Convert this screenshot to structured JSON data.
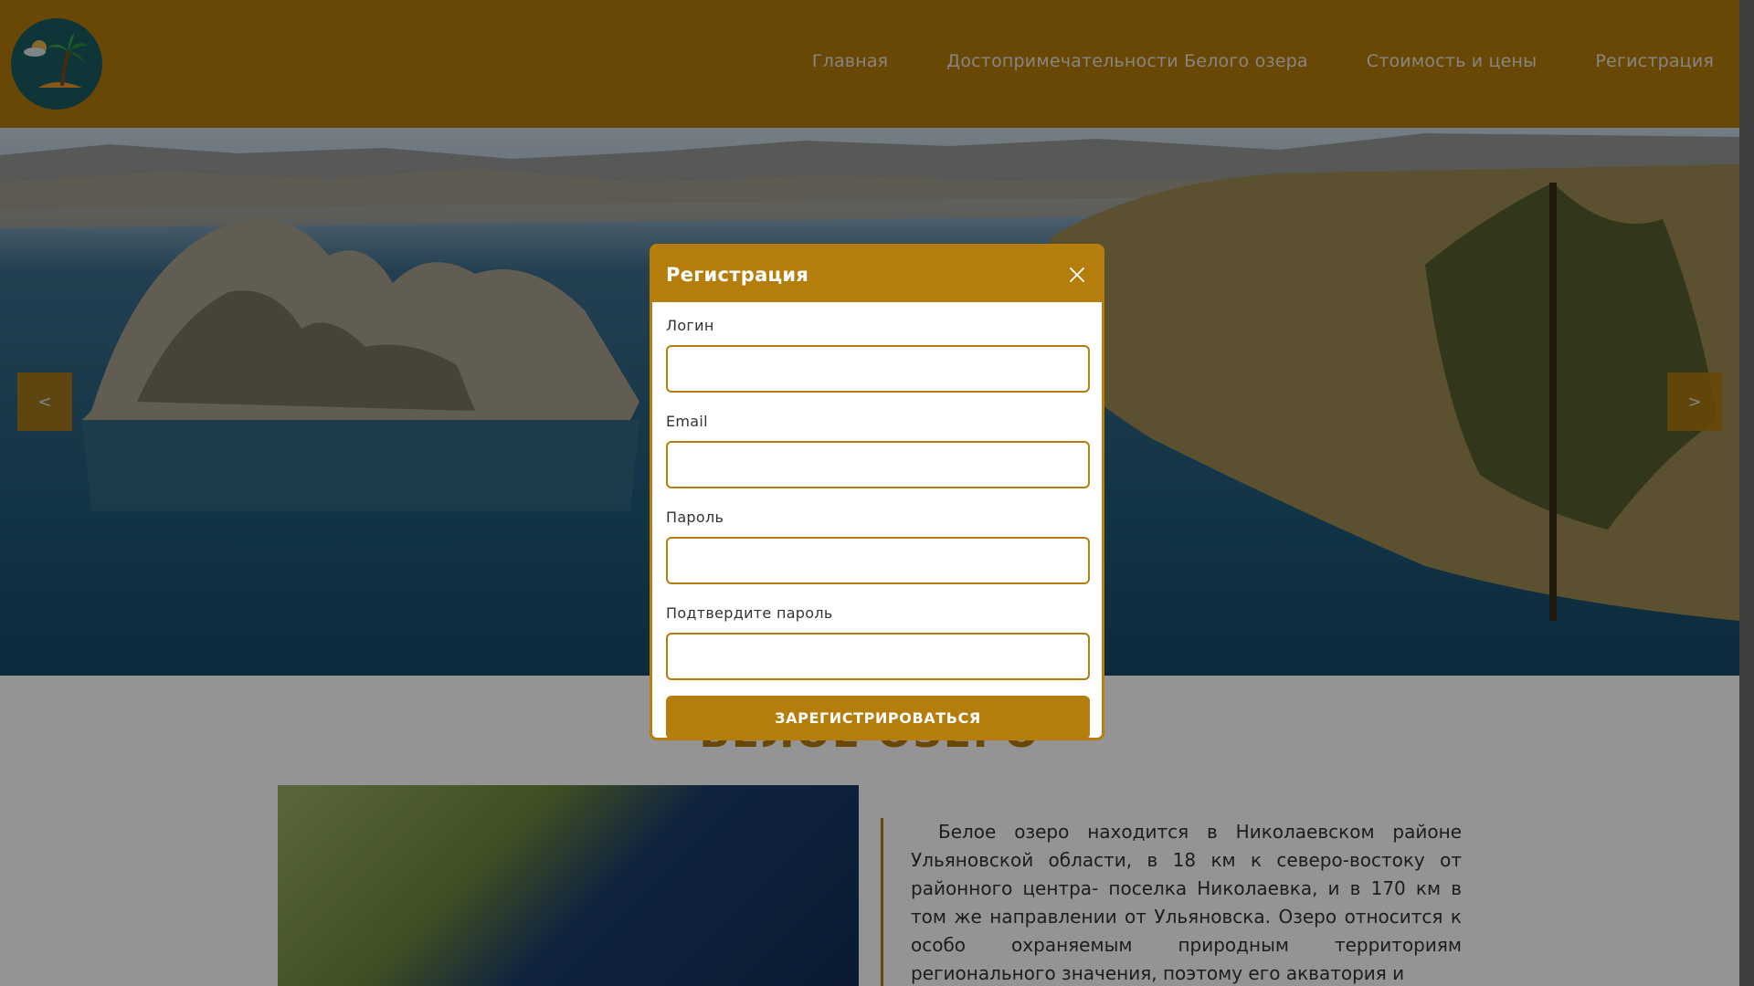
{
  "header": {
    "logo_icon": "palm-island-icon",
    "nav": [
      {
        "label": "Главная"
      },
      {
        "label": "Достопримечательности Белого озера"
      },
      {
        "label": "Стоимость и цены"
      },
      {
        "label": "Регистрация"
      }
    ]
  },
  "hero": {
    "prev_label": "<",
    "next_label": ">"
  },
  "section": {
    "title": "БЕЛОЕ ОЗЕРО",
    "text": "Белое озеро находится в Николаевском районе Ульяновской области, в 18 км к северо-востоку от районного центра- поселка Николаевка, и в 170 км в том же направлении от Ульяновска. Озеро относится к особо охраняемым природным территориям регионального значения, поэтому его акватория и"
  },
  "modal": {
    "title": "Регистрация",
    "close_icon": "close-icon",
    "fields": [
      {
        "label": "Логин",
        "value": ""
      },
      {
        "label": "Email",
        "value": ""
      },
      {
        "label": "Пароль",
        "value": ""
      },
      {
        "label": "Подтвердите пароль",
        "value": ""
      }
    ],
    "submit_label": "ЗАРЕГИСТРИРОВАТЬСЯ"
  },
  "colors": {
    "accent": "#b57d0c",
    "logo_bg": "#1c5c63",
    "overlay": "rgba(0,0,0,0.42)"
  }
}
